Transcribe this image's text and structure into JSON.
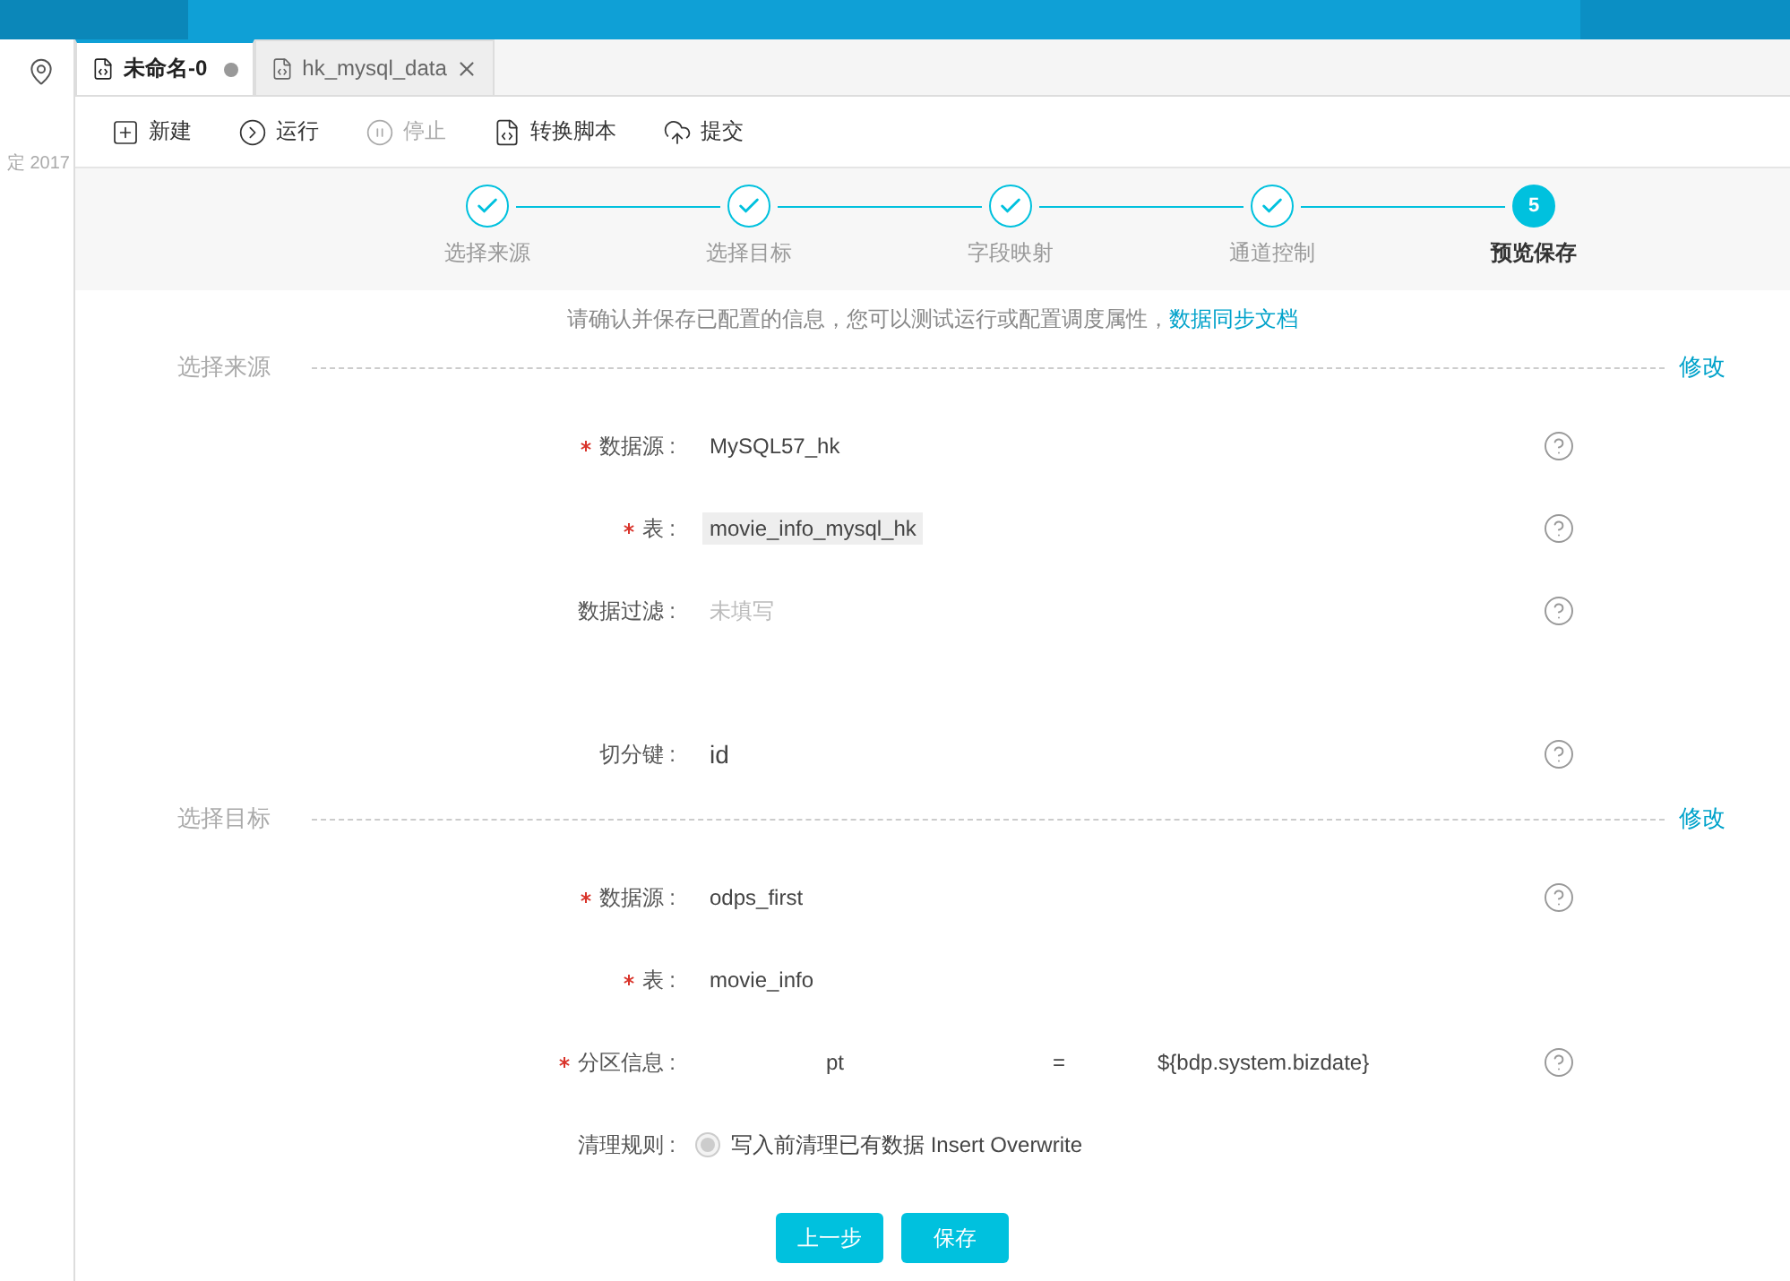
{
  "sidebar": {
    "date_text": "定 2017"
  },
  "tabs": [
    {
      "label": "未命名-0",
      "selected": true,
      "modified": true
    },
    {
      "label": "hk_mysql_data",
      "selected": false,
      "modified": false
    }
  ],
  "toolbar": [
    {
      "label": "新建",
      "disabled": false
    },
    {
      "label": "运行",
      "disabled": false
    },
    {
      "label": "停止",
      "disabled": true
    },
    {
      "label": "转换脚本",
      "disabled": false
    },
    {
      "label": "提交",
      "disabled": false
    }
  ],
  "steps": [
    {
      "label": "选择来源",
      "done": true,
      "selected": false
    },
    {
      "label": "选择目标",
      "done": true,
      "selected": false
    },
    {
      "label": "字段映射",
      "done": true,
      "selected": false
    },
    {
      "label": "通道控制",
      "done": true,
      "selected": false
    },
    {
      "label": "预览保存",
      "done": false,
      "selected": true,
      "number": "5"
    }
  ],
  "notice": {
    "text": "请确认并保存已配置的信息，您可以测试运行或配置调度属性，",
    "link": "数据同步文档"
  },
  "sections": [
    {
      "title": "选择来源",
      "action": "修改",
      "fields": [
        {
          "kind": "text",
          "label": "数据源 :",
          "required": true,
          "value": "MySQL57_hk",
          "help": true
        },
        {
          "kind": "tag",
          "label": "表 :",
          "required": true,
          "value": "movie_info_mysql_hk",
          "help": true
        },
        {
          "kind": "empty",
          "label": "数据过滤 :",
          "required": false,
          "placeholder": "未填写",
          "help": true
        },
        {
          "kind": "key",
          "label": "切分键 :",
          "required": false,
          "value": "id",
          "help": true
        }
      ]
    },
    {
      "title": "选择目标",
      "action": "修改",
      "fields": [
        {
          "kind": "text",
          "label": "数据源 :",
          "required": true,
          "value": "odps_first",
          "help": true
        },
        {
          "kind": "text",
          "label": "表 :",
          "required": true,
          "value": "movie_info",
          "help": false
        },
        {
          "kind": "partition",
          "label": "分区信息 :",
          "required": true,
          "name": "pt",
          "operator": "=",
          "value": "${bdp.system.bizdate}",
          "help": true
        },
        {
          "kind": "radio",
          "label": "清理规则 :",
          "required": false,
          "value": "写入前清理已有数据 Insert Overwrite",
          "selected": true,
          "help": false
        }
      ]
    }
  ],
  "buttons": [
    {
      "label": "上一步"
    },
    {
      "label": "保存"
    }
  ]
}
